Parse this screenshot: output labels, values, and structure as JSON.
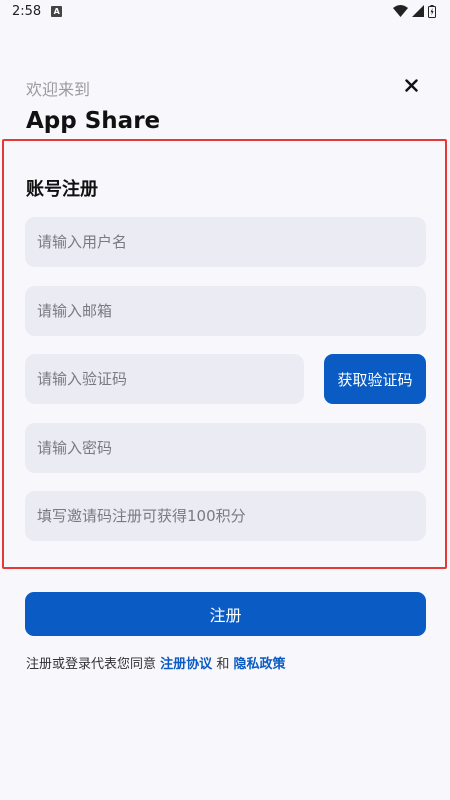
{
  "status_bar": {
    "time": "2:58",
    "notification_letter": "A"
  },
  "header": {
    "welcome": "欢迎来到",
    "app_name": "App Share"
  },
  "form": {
    "title": "账号注册",
    "username_placeholder": "请输入用户名",
    "email_placeholder": "请输入邮箱",
    "code_placeholder": "请输入验证码",
    "get_code_label": "获取验证码",
    "password_placeholder": "请输入密码",
    "invite_placeholder": "填写邀请码注册可获得100积分"
  },
  "actions": {
    "register_label": "注册"
  },
  "agreement": {
    "prefix": "注册或登录代表您同意",
    "terms_link": "注册协议",
    "conjunction": "和",
    "privacy_link": "隐私政策"
  },
  "colors": {
    "accent": "#0a5bc4",
    "highlight_border": "#e53935",
    "field_bg": "#ebebf3",
    "page_bg": "#f8f7fc"
  }
}
